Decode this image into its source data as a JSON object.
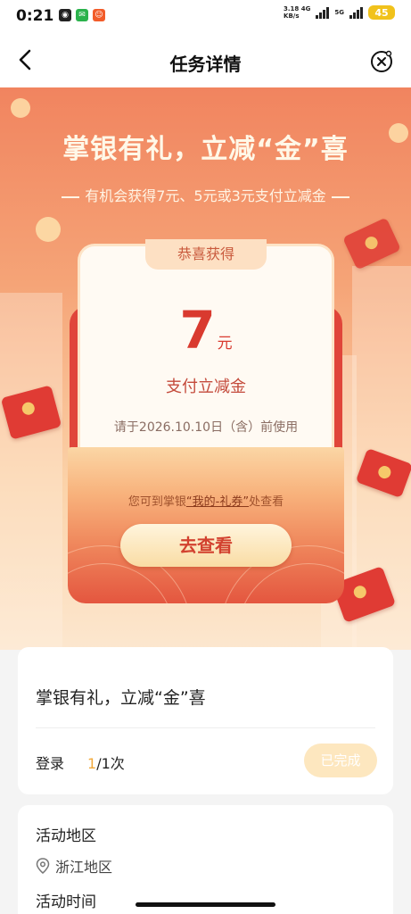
{
  "status_bar": {
    "time": "0:21",
    "net_speed": "3.18",
    "net_unit": "KB/s",
    "net_type": "4G",
    "net_type2": "5G",
    "battery": "45"
  },
  "nav": {
    "title": "任务详情",
    "back_icon": "chevron-left-icon",
    "close_icon": "close-circle-icon"
  },
  "hero": {
    "title": "掌银有礼，立减“金”喜",
    "subtitle": "有机会获得7元、5元或3元支付立减金"
  },
  "reward": {
    "badge": "恭喜获得",
    "amount": "7",
    "unit": "元",
    "type": "支付立减金",
    "expiry": "请于2026.10.10日（含）前使用",
    "hint_prefix": "您可到掌银",
    "hint_link": "“我的-礼券”",
    "hint_suffix": "处查看",
    "view_button": "去查看"
  },
  "task": {
    "title": "掌银有礼，立减“金”喜",
    "label": "登录",
    "progress_done": "1",
    "progress_total": "/1次",
    "status_button": "已完成"
  },
  "area": {
    "label": "活动地区",
    "value": "浙江地区",
    "icon": "location-pin-icon",
    "time_label": "活动时间"
  },
  "colors": {
    "hero_top": "#f1845f",
    "accent_red": "#d93a2f",
    "done_orange": "#f2a93a"
  }
}
